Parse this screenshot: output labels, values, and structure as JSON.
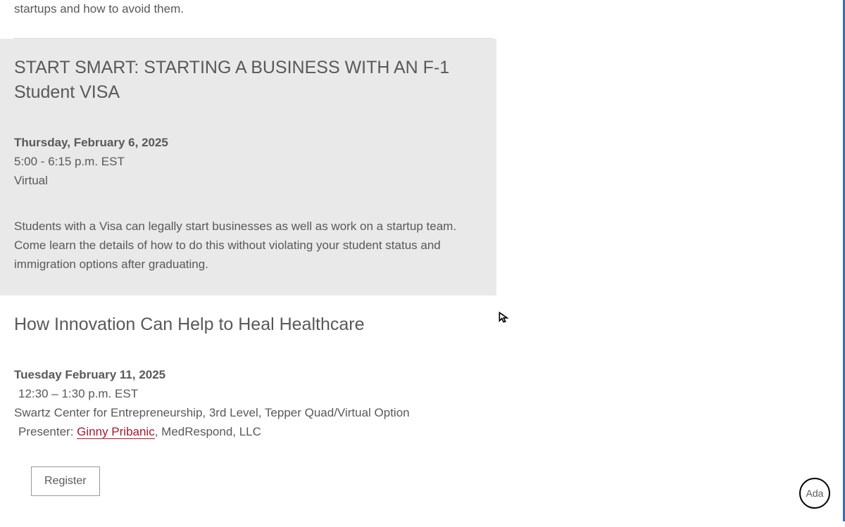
{
  "intro_fragment": "startups and how to avoid them.",
  "events": [
    {
      "title": "START SMART: STARTING A BUSINESS WITH AN F-1 Student VISA",
      "date": "Thursday, February 6, 2025",
      "time": "5:00 - 6:15 p.m. EST",
      "location": "Virtual",
      "description": "Students with a Visa can legally start businesses as well as work on a startup team. Come learn the details of how to do this without violating your student status and immigration options after graduating."
    },
    {
      "title": "How Innovation Can Help to Heal Healthcare",
      "date": "Tuesday February 11, 2025",
      "time": "12:30 – 1:30 p.m. EST",
      "location": "Swartz Center for Entrepreneurship, 3rd Level, Tepper Quad/Virtual Option",
      "presenter_label": "Presenter: ",
      "presenter_name": "Ginny Pribanic",
      "presenter_org": ", MedRespond, LLC",
      "register_label": "Register"
    }
  ],
  "ada_label": "Ada"
}
